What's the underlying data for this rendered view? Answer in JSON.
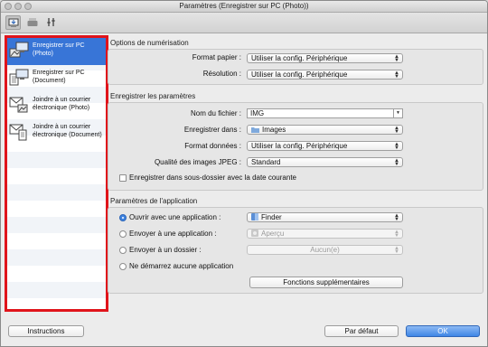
{
  "window": {
    "title": "Paramètres (Enregistrer sur PC (Photo))"
  },
  "toolbar": {
    "tabs": [
      "scan-from-computer-icon",
      "scan-from-operation-panel-icon",
      "general-settings-icon"
    ]
  },
  "sidebar": {
    "items": [
      {
        "label": "Enregistrer sur PC (Photo)",
        "icon": "photo-to-pc-icon",
        "selected": true
      },
      {
        "label": "Enregistrer sur PC (Document)",
        "icon": "document-to-pc-icon",
        "selected": false
      },
      {
        "label": "Joindre à un courrier électronique (Photo)",
        "icon": "email-photo-icon",
        "selected": false
      },
      {
        "label": "Joindre à un courrier électronique (Document)",
        "icon": "email-document-icon",
        "selected": false
      }
    ]
  },
  "scan_options": {
    "heading": "Options de numérisation",
    "paper_size_label": "Format papier :",
    "paper_size_value": "Utiliser la config. Périphérique",
    "resolution_label": "Résolution :",
    "resolution_value": "Utiliser la config. Périphérique"
  },
  "save_settings": {
    "heading": "Enregistrer les paramètres",
    "filename_label": "Nom du fichier :",
    "filename_value": "IMG",
    "save_in_label": "Enregistrer dans :",
    "save_in_value": "Images",
    "data_format_label": "Format données :",
    "data_format_value": "Utiliser la config. Périphérique",
    "jpeg_quality_label": "Qualité des images JPEG :",
    "jpeg_quality_value": "Standard",
    "subfolder_label": "Enregistrer dans sous-dossier avec la date courante"
  },
  "app_settings": {
    "heading": "Paramètres de l'application",
    "open_with_label": "Ouvrir avec une application :",
    "open_with_value": "Finder",
    "send_to_app_label": "Envoyer à une application :",
    "send_to_app_value": "Aperçu",
    "send_to_folder_label": "Envoyer à un dossier :",
    "send_to_folder_value": "Aucun(e)",
    "no_app_label": "Ne démarrez aucune application",
    "more_functions_label": "Fonctions supplémentaires"
  },
  "footer": {
    "instructions_label": "Instructions",
    "defaults_label": "Par défaut",
    "ok_label": "OK"
  },
  "colors": {
    "selection": "#3875d7",
    "highlight_border": "#e0141b",
    "ok_button": "#3e86e6"
  }
}
